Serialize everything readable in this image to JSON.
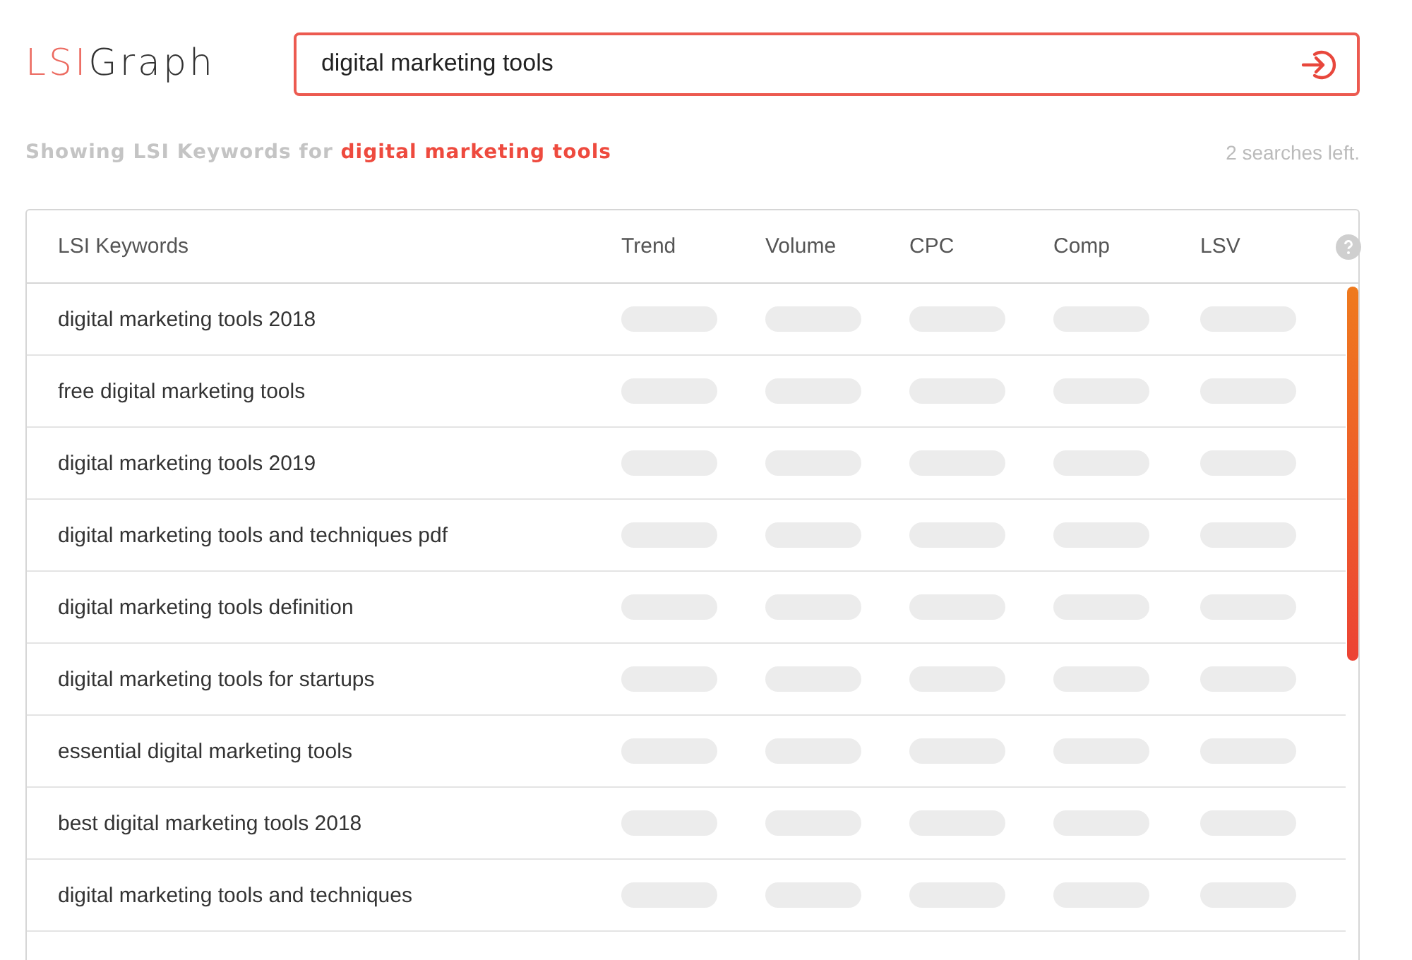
{
  "logo": {
    "part_1": "LSI",
    "part_2": "Graph"
  },
  "search": {
    "value": "digital marketing tools"
  },
  "summary": {
    "prefix": "Showing LSI Keywords for",
    "query": "digital marketing tools",
    "searches_left": "2 searches left."
  },
  "table": {
    "columns": [
      "LSI Keywords",
      "Trend",
      "Volume",
      "CPC",
      "Comp",
      "LSV"
    ],
    "rows": [
      {
        "keyword": "digital marketing tools 2018"
      },
      {
        "keyword": "free digital marketing tools"
      },
      {
        "keyword": "digital marketing tools 2019"
      },
      {
        "keyword": "digital marketing tools and techniques pdf"
      },
      {
        "keyword": "digital marketing tools definition"
      },
      {
        "keyword": "digital marketing tools for startups"
      },
      {
        "keyword": "essential digital marketing tools"
      },
      {
        "keyword": "best digital marketing tools 2018"
      },
      {
        "keyword": "digital marketing tools and techniques"
      }
    ]
  }
}
